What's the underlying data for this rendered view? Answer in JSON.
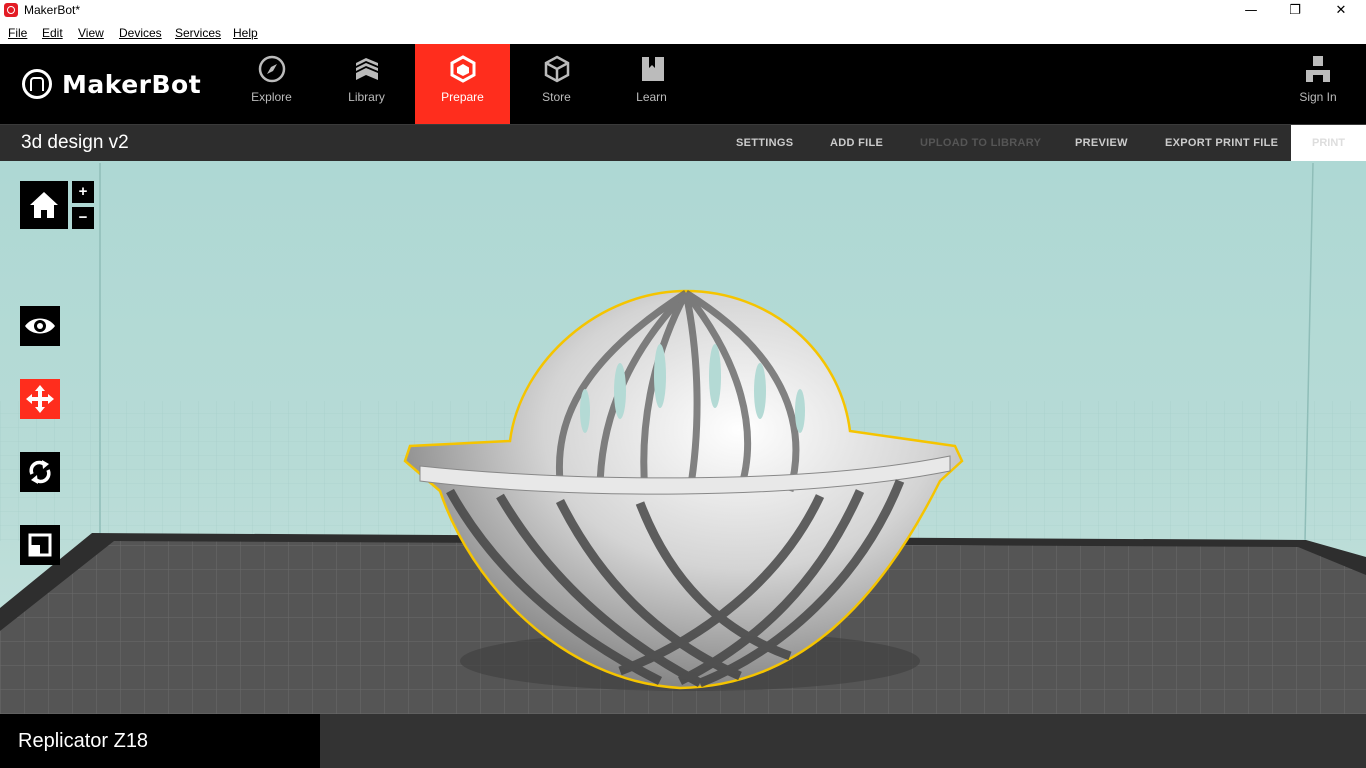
{
  "window": {
    "title": "MakerBot*",
    "minimize": "—",
    "maximize": "❐",
    "close": "✕"
  },
  "menu": [
    "File",
    "Edit",
    "View",
    "Devices",
    "Services",
    "Help"
  ],
  "brand": {
    "name": "MakerBot"
  },
  "nav": {
    "tabs": [
      {
        "label": "Explore",
        "icon": "compass-icon"
      },
      {
        "label": "Library",
        "icon": "stack-icon"
      },
      {
        "label": "Prepare",
        "icon": "prepare-cube-icon",
        "active": true
      },
      {
        "label": "Store",
        "icon": "box-icon"
      },
      {
        "label": "Learn",
        "icon": "book-icon"
      }
    ],
    "sign_in": "Sign In"
  },
  "toolbar": {
    "project_title": "3d design v2",
    "settings": "SETTINGS",
    "add_file": "ADD FILE",
    "upload": "UPLOAD TO LIBRARY",
    "preview": "PREVIEW",
    "export": "EXPORT PRINT FILE",
    "print": "PRINT"
  },
  "view_controls": {
    "zoom_in": "+",
    "zoom_out": "−"
  },
  "colors": {
    "accent": "#ff2d1d",
    "selection_outline": "#f5c400"
  },
  "footer": {
    "printer": "Replicator Z18"
  }
}
